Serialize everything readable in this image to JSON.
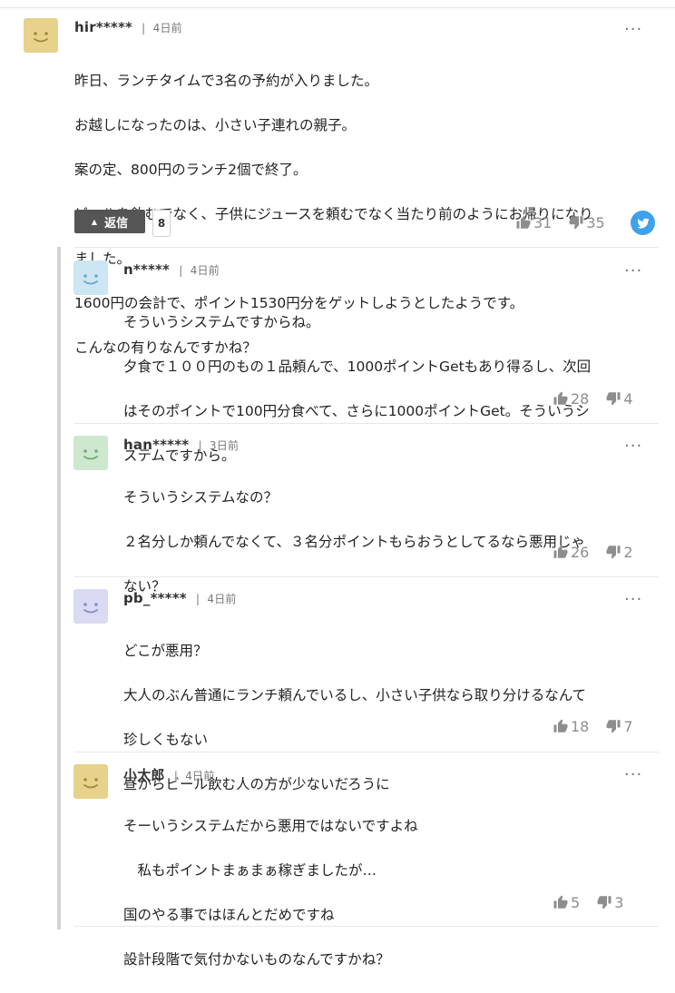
{
  "main_comment": {
    "username": "hir*****",
    "date": "4日前",
    "avatar_color": "#e6d28a",
    "more_label": "···",
    "lines": [
      "昨日、ランチタイムで3名の予約が入りました。",
      "お越しになったのは、小さい子連れの親子。",
      "案の定、800円のランチ2個で終了。",
      "ビールを飲むでなく、子供にジュースを頼むでなく当たり前のようにお帰りになり",
      "ました。",
      "1600円の会計で、ポイント1530円分をゲットしようとしたようです。",
      "こんなの有りなんですかね？"
    ],
    "reply_label": "返信",
    "reply_count": "8",
    "likes": "31",
    "dislikes": "35",
    "share_icon": "twitter-icon"
  },
  "replies": [
    {
      "username": "n*****",
      "date": "4日前",
      "avatar_color": "#cde6f3",
      "lines": [
        "そういうシステムですからね。",
        "夕食で１００円のもの１品頼んで、1000ポイントGetもあり得るし、次回",
        "はそのポイントで100円分食べて、さらに1000ポイントGet。そういうシ",
        "ステムですから。"
      ],
      "likes": "28",
      "dislikes": "4"
    },
    {
      "username": "han*****",
      "date": "3日前",
      "avatar_color": "#cde8cf",
      "lines": [
        "そういうシステムなの？",
        "２名分しか頼んでなくて、３名分ポイントもらおうとしてるなら悪用じゃ",
        "ない？"
      ],
      "likes": "26",
      "dislikes": "2"
    },
    {
      "username": "pb_*****",
      "date": "4日前",
      "avatar_color": "#dadaf2",
      "lines": [
        "どこが悪用？",
        "大人のぶん普通にランチ頼んでいるし、小さい子供なら取り分けるなんて",
        "珍しくもない",
        "昼からビール飲む人の方が少ないだろうに"
      ],
      "likes": "18",
      "dislikes": "7"
    },
    {
      "username": "小太郎",
      "date": "4日前",
      "avatar_color": "#e6d28a",
      "lines": [
        "そーいうシステムだから悪用ではないですよね",
        "　私もポイントまぁまぁ稼ぎましたが…",
        "国のやる事ではほんとだめですね",
        "設計段階で気付かないものなんですかね？"
      ],
      "likes": "5",
      "dislikes": "3"
    }
  ],
  "colors": {
    "accent_twitter": "#3ea1e9",
    "reply_button": "#555555",
    "vote_text": "#8d8d8d"
  }
}
